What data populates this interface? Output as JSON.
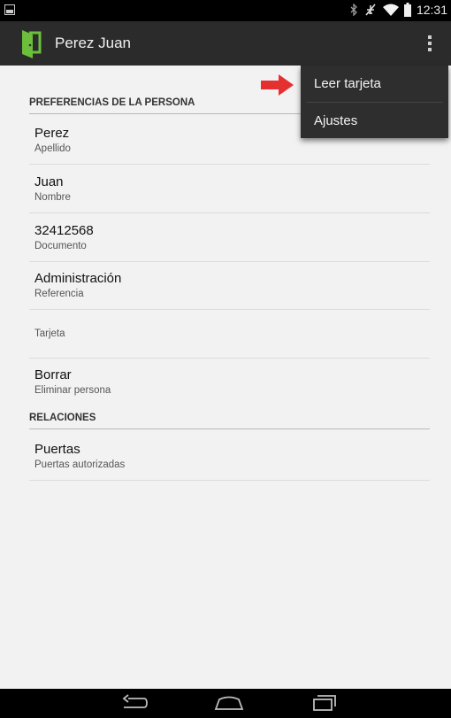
{
  "status_bar": {
    "time": "12:31",
    "icons": [
      "gallery-icon",
      "bluetooth-icon",
      "airplane-icon",
      "wifi-icon",
      "battery-icon"
    ]
  },
  "action_bar": {
    "title": "Perez Juan",
    "app_icon": "door-icon",
    "accent": "#6cbf3b"
  },
  "sections": {
    "person_prefs": "PREFERENCIAS DE LA PERSONA",
    "relations": "RELACIONES"
  },
  "items": [
    {
      "primary": "Perez",
      "secondary": "Apellido"
    },
    {
      "primary": "Juan",
      "secondary": "Nombre"
    },
    {
      "primary": "32412568",
      "secondary": "Documento"
    },
    {
      "primary": "Administración",
      "secondary": "Referencia"
    },
    {
      "primary": "",
      "secondary": "Tarjeta"
    },
    {
      "primary": "Borrar",
      "secondary": "Eliminar persona"
    },
    {
      "primary": "Puertas",
      "secondary": "Puertas autorizadas"
    }
  ],
  "menu": {
    "items": [
      "Leer tarjeta",
      "Ajustes"
    ],
    "pointer_color": "#e53030"
  },
  "nav_bar": {
    "buttons": [
      "back-icon",
      "home-icon",
      "recents-icon"
    ]
  }
}
